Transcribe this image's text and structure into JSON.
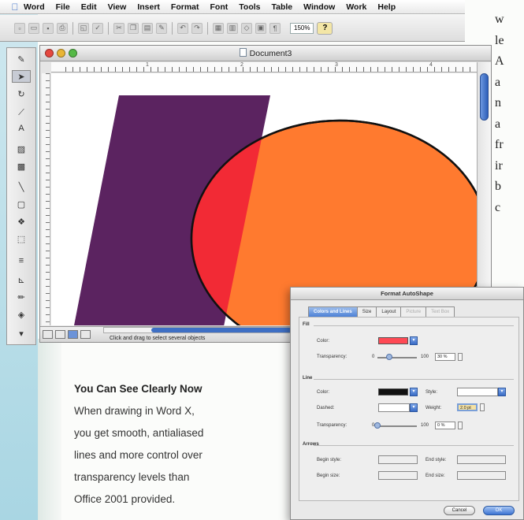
{
  "menubar": {
    "items": [
      "Word",
      "File",
      "Edit",
      "View",
      "Insert",
      "Format",
      "Font",
      "Tools",
      "Table",
      "Window",
      "Work",
      "Help"
    ]
  },
  "toolbar": {
    "zoom": "150%",
    "help": "?"
  },
  "document": {
    "title": "Document3",
    "status_text": "Click and drag to select several objects"
  },
  "ruler": {
    "numbers": [
      "1",
      "2",
      "3",
      "4"
    ]
  },
  "shapes": {
    "parallelogram_color": "#5b2360",
    "ellipse_color": "#ff7a2f",
    "overlap_color": "#f22a35"
  },
  "article": {
    "right_column_letters": [
      "w",
      "le",
      "A",
      "a",
      "n",
      "a",
      "fr",
      "ir",
      "b",
      "c"
    ]
  },
  "caption": {
    "title": "You Can See Clearly Now",
    "lines": [
      "When drawing in Word X,",
      "you get smooth, antialiased",
      "lines and more control over",
      "transparency levels than",
      "Office 2001 provided."
    ]
  },
  "dialog": {
    "title": "Format AutoShape",
    "tabs": [
      "Colors and Lines",
      "Size",
      "Layout",
      "Picture",
      "Text Box"
    ],
    "fill": {
      "group": "Fill",
      "color_label": "Color:",
      "color_value": "#ff4a55",
      "transparency_label": "Transparency:",
      "min": "0",
      "max": "100",
      "value": "30 %"
    },
    "line": {
      "group": "Line",
      "color_label": "Color:",
      "style_label": "Style:",
      "dashed_label": "Dashed:",
      "weight_label": "Weight:",
      "weight_value": "2.0 pt",
      "transparency_label": "Transparency:",
      "min": "0",
      "max": "100",
      "value": "0 %"
    },
    "arrows": {
      "group": "Arrows",
      "begin_style": "Begin style:",
      "end_style": "End style:",
      "begin_size": "Begin size:",
      "end_size": "End size:"
    },
    "cancel": "Cancel",
    "ok": "OK"
  }
}
